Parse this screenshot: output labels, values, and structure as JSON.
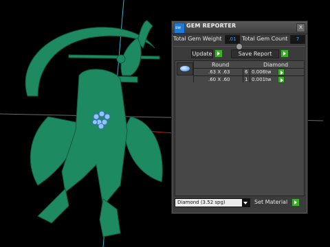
{
  "panel": {
    "title": "GEM REPORTER",
    "close_label": "x",
    "icon_text": "sw",
    "total_gem_weight_label": "Total Gem Weight",
    "total_gem_weight_value": ".01",
    "total_gem_count_label": "Total Gem Count",
    "total_gem_count_value": "7",
    "update_label": "Update",
    "save_report_label": "Save Report",
    "table": {
      "headers": [
        "Round",
        "Diamond"
      ],
      "rows": [
        {
          "size": ".63 X .63",
          "count": "6",
          "weight": "0.006tw"
        },
        {
          "size": ".60 X .60",
          "count": "1",
          "weight": "0.001tw"
        }
      ]
    },
    "material_select_value": "Diamond     (3.52 spg)",
    "set_material_label": "Set Material"
  },
  "colors": {
    "model_green": "#1e8a62",
    "accent_blue": "#3aa0ff",
    "button_green": "#3cae2a"
  },
  "icons": {
    "app_icon": "app-logo-icon",
    "close": "close-icon",
    "go": "play-arrow-icon",
    "gem": "gem-icon",
    "dropdown": "chevron-down-icon"
  }
}
